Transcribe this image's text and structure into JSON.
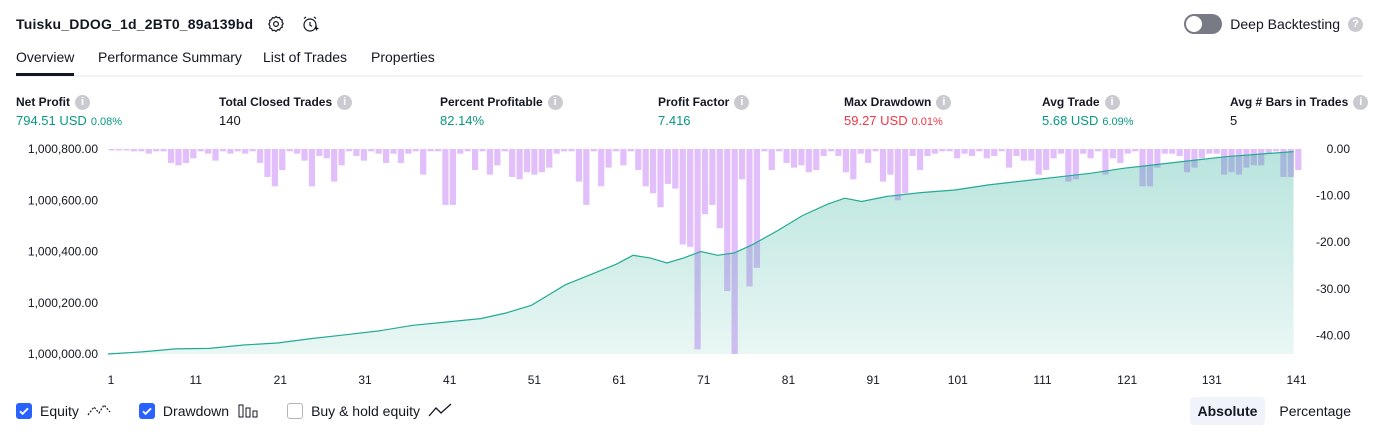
{
  "header": {
    "title": "Tuisku_DDOG_1d_2BT0_89a139bd",
    "icons": [
      "gear-icon",
      "alarm-add-icon"
    ],
    "deep_backtesting_label": "Deep Backtesting",
    "deep_backtesting_on": false
  },
  "tabs": [
    {
      "label": "Overview",
      "active": true
    },
    {
      "label": "Performance Summary",
      "active": false
    },
    {
      "label": "List of Trades",
      "active": false
    },
    {
      "label": "Properties",
      "active": false
    }
  ],
  "stats": {
    "net_profit": {
      "label": "Net Profit",
      "value": "794.51 USD",
      "pct": "0.08%"
    },
    "total_closed_trades": {
      "label": "Total Closed Trades",
      "value": "140"
    },
    "percent_profitable": {
      "label": "Percent Profitable",
      "value": "82.14%"
    },
    "profit_factor": {
      "label": "Profit Factor",
      "value": "7.416"
    },
    "max_drawdown": {
      "label": "Max Drawdown",
      "value": "59.27 USD",
      "pct": "0.01%"
    },
    "avg_trade": {
      "label": "Avg Trade",
      "value": "5.68 USD",
      "pct": "6.09%"
    },
    "avg_bars": {
      "label": "Avg # Bars in Trades",
      "value": "5"
    }
  },
  "colors": {
    "positive": "#089981",
    "negative": "#f23645",
    "equity_line": "#22ab94",
    "drawdown_bar": "#ce93f9",
    "accent": "#2962ff"
  },
  "chart_data": {
    "type": "area",
    "left_axis": {
      "ticks": [
        "1,000,000.00",
        "1,000,200.00",
        "1,000,400.00",
        "1,000,600.00",
        "1,000,800.00"
      ],
      "range": [
        1000000,
        1000800
      ]
    },
    "right_axis": {
      "ticks": [
        "0.00",
        "-10.00",
        "-20.00",
        "-30.00",
        "-40.00"
      ],
      "range": [
        -44,
        0
      ]
    },
    "x_ticks": [
      "1",
      "11",
      "21",
      "31",
      "41",
      "51",
      "61",
      "71",
      "81",
      "91",
      "101",
      "111",
      "121",
      "131",
      "141"
    ],
    "x_range": [
      1,
      142
    ],
    "series": [
      {
        "name": "Equity",
        "type": "area",
        "axis": "left",
        "points": [
          [
            1,
            1000000
          ],
          [
            5,
            1000008
          ],
          [
            9,
            1000020
          ],
          [
            13,
            1000022
          ],
          [
            17,
            1000035
          ],
          [
            21,
            1000043
          ],
          [
            25,
            1000060
          ],
          [
            29,
            1000075
          ],
          [
            33,
            1000090
          ],
          [
            37,
            1000112
          ],
          [
            41,
            1000125
          ],
          [
            45,
            1000138
          ],
          [
            48,
            1000160
          ],
          [
            51,
            1000190
          ],
          [
            53,
            1000230
          ],
          [
            55,
            1000270
          ],
          [
            58,
            1000310
          ],
          [
            61,
            1000350
          ],
          [
            63,
            1000385
          ],
          [
            65,
            1000375
          ],
          [
            67,
            1000355
          ],
          [
            69,
            1000375
          ],
          [
            71,
            1000400
          ],
          [
            73,
            1000385
          ],
          [
            75,
            1000395
          ],
          [
            77,
            1000425
          ],
          [
            80,
            1000480
          ],
          [
            83,
            1000540
          ],
          [
            86,
            1000585
          ],
          [
            88,
            1000608
          ],
          [
            90,
            1000595
          ],
          [
            93,
            1000615
          ],
          [
            97,
            1000630
          ],
          [
            101,
            1000640
          ],
          [
            105,
            1000660
          ],
          [
            109,
            1000675
          ],
          [
            113,
            1000690
          ],
          [
            117,
            1000705
          ],
          [
            121,
            1000725
          ],
          [
            125,
            1000740
          ],
          [
            129,
            1000755
          ],
          [
            133,
            1000770
          ],
          [
            137,
            1000780
          ],
          [
            141,
            1000790
          ]
        ]
      },
      {
        "name": "Drawdown",
        "type": "bar",
        "axis": "right",
        "values": [
          0.3,
          0.3,
          0.3,
          0.5,
          0.5,
          1.0,
          0.5,
          0.5,
          3.0,
          3.5,
          3.0,
          2.0,
          0.5,
          1.0,
          2.5,
          0.5,
          1.0,
          0.5,
          1.0,
          0.5,
          3.0,
          6.0,
          8.0,
          4.5,
          0.5,
          1.0,
          2.5,
          8.0,
          1.5,
          2.0,
          7.0,
          3.5,
          0.5,
          1.5,
          2.5,
          0.5,
          1.0,
          3.0,
          1.0,
          3.0,
          1.0,
          0.5,
          5.5,
          0.5,
          0.5,
          12.0,
          12.0,
          1.0,
          0.5,
          4.5,
          0.5,
          5.5,
          3.5,
          0.5,
          6.0,
          6.5,
          5.0,
          5.5,
          5.0,
          4.0,
          1.0,
          0.5,
          0.5,
          7.0,
          12.0,
          0.5,
          8.0,
          4.0,
          0.5,
          3.5,
          0.5,
          4.5,
          8.0,
          9.5,
          12.5,
          7.5,
          8.5,
          20.5,
          21.0,
          43.0,
          14.0,
          12.0,
          17.0,
          30.5,
          44.0,
          6.5,
          29.5,
          25.5,
          0.5,
          4.5,
          0.5,
          3.0,
          4.0,
          3.5,
          5.0,
          4.5,
          1.5,
          0.5,
          1.5,
          5.0,
          6.5,
          1.0,
          3.0,
          0.5,
          7.0,
          5.5,
          11.0,
          9.5,
          1.5,
          4.5,
          1.5,
          1.0,
          0.5,
          0.5,
          2.0,
          1.0,
          1.5,
          0.5,
          2.0,
          1.5,
          0.5,
          4.0,
          1.5,
          2.5,
          2.5,
          5.5,
          4.5,
          2.0,
          1.0,
          7.0,
          6.5,
          1.0,
          2.0,
          0.5,
          5.5,
          2.0,
          3.0,
          1.0,
          0.5,
          8.0,
          8.0,
          4.0,
          1.0,
          1.0,
          1.5,
          5.0,
          4.0,
          2.0,
          1.0,
          1.0,
          5.5,
          5.0,
          5.5,
          4.0,
          3.5,
          3.5,
          1.0,
          0.5,
          6.0,
          6.0,
          4.5
        ]
      }
    ]
  },
  "legend": [
    {
      "label": "Equity",
      "checked": true,
      "icon": "equity-line-icon"
    },
    {
      "label": "Drawdown",
      "checked": true,
      "icon": "drawdown-bars-icon"
    },
    {
      "label": "Buy & hold equity",
      "checked": false,
      "icon": "buy-hold-line-icon"
    }
  ],
  "view_modes": [
    {
      "label": "Absolute",
      "active": true
    },
    {
      "label": "Percentage",
      "active": false
    }
  ]
}
